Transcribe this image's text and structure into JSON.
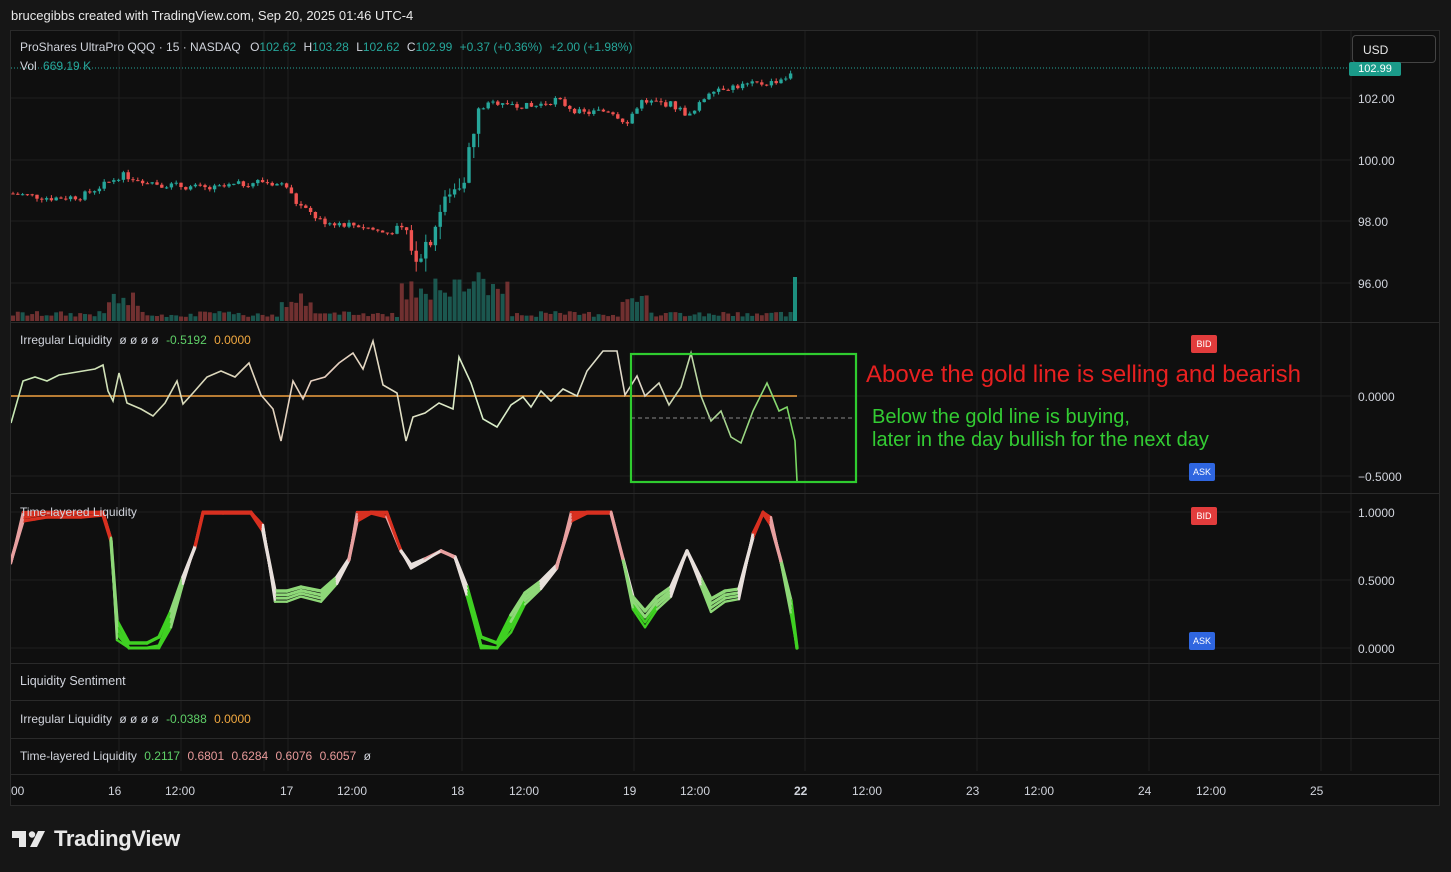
{
  "header": {
    "credit": "brucegibbs created with TradingView.com, Sep 20, 2025 01:46 UTC-4"
  },
  "main_pane": {
    "symbol": "ProShares UltraPro QQQ · 15 · NASDAQ",
    "o_label": "O",
    "o_value": "102.62",
    "h_label": "H",
    "h_value": "103.28",
    "l_label": "L",
    "l_value": "102.62",
    "c_label": "C",
    "c_value": "102.99",
    "change": "+0.37 (+0.36%)",
    "extended_change": "+2.00 (+1.98%)",
    "vol_label": "Vol",
    "vol_value": "669.19 K",
    "currency_button": "USD",
    "last_price": "102.99",
    "price_ticks": [
      "102.00",
      "100.00",
      "98.00",
      "96.00"
    ],
    "last_volume_fraction": 1.0
  },
  "irregular_pane": {
    "title": "Irregular Liquidity",
    "placeholders": "ø  ø  ø  ø",
    "value1": "-0.5192",
    "value2": "0.0000",
    "ticks": [
      "0.0000",
      "−0.5000"
    ],
    "bid_badge": "BID",
    "ask_badge": "ASK"
  },
  "annotations": {
    "bearish": "Above the gold line is selling and bearish",
    "bullish_line1": "Below the gold line is buying,",
    "bullish_line2": "later in the day bullish for the next day",
    "red_color": "#e82020",
    "green_color": "#33cc33"
  },
  "time_pane": {
    "title": "Time-layered Liquidity",
    "ticks": [
      "1.0000",
      "0.5000",
      "0.0000"
    ],
    "bid_badge": "BID",
    "ask_badge": "ASK"
  },
  "collapsed": {
    "sentiment_title": "Liquidity Sentiment",
    "irregular_title": "Irregular Liquidity",
    "irregular_placeholders": "ø  ø  ø  ø",
    "irregular_value1": "-0.0388",
    "irregular_value2": "0.0000",
    "time_title": "Time-layered Liquidity",
    "time_v1": "0.2117",
    "time_v2": "0.6801",
    "time_v3": "0.6284",
    "time_v4": "0.6076",
    "time_v5": "0.6057",
    "time_tail": "ø"
  },
  "time_axis": [
    "00",
    "16",
    "12:00",
    "17",
    "12:00",
    "18",
    "12:00",
    "19",
    "12:00",
    "22",
    "12:00",
    "23",
    "12:00",
    "24",
    "12:00",
    "25"
  ],
  "brand": {
    "logo_text": "TradingView"
  },
  "colors": {
    "up": "#26a69a",
    "down": "#ef5350",
    "gold_line": "#f0a040",
    "buy_green": "#3fd022",
    "sell_red": "#e02818",
    "bid": "#e23c3c",
    "ask": "#2f66e0"
  }
}
